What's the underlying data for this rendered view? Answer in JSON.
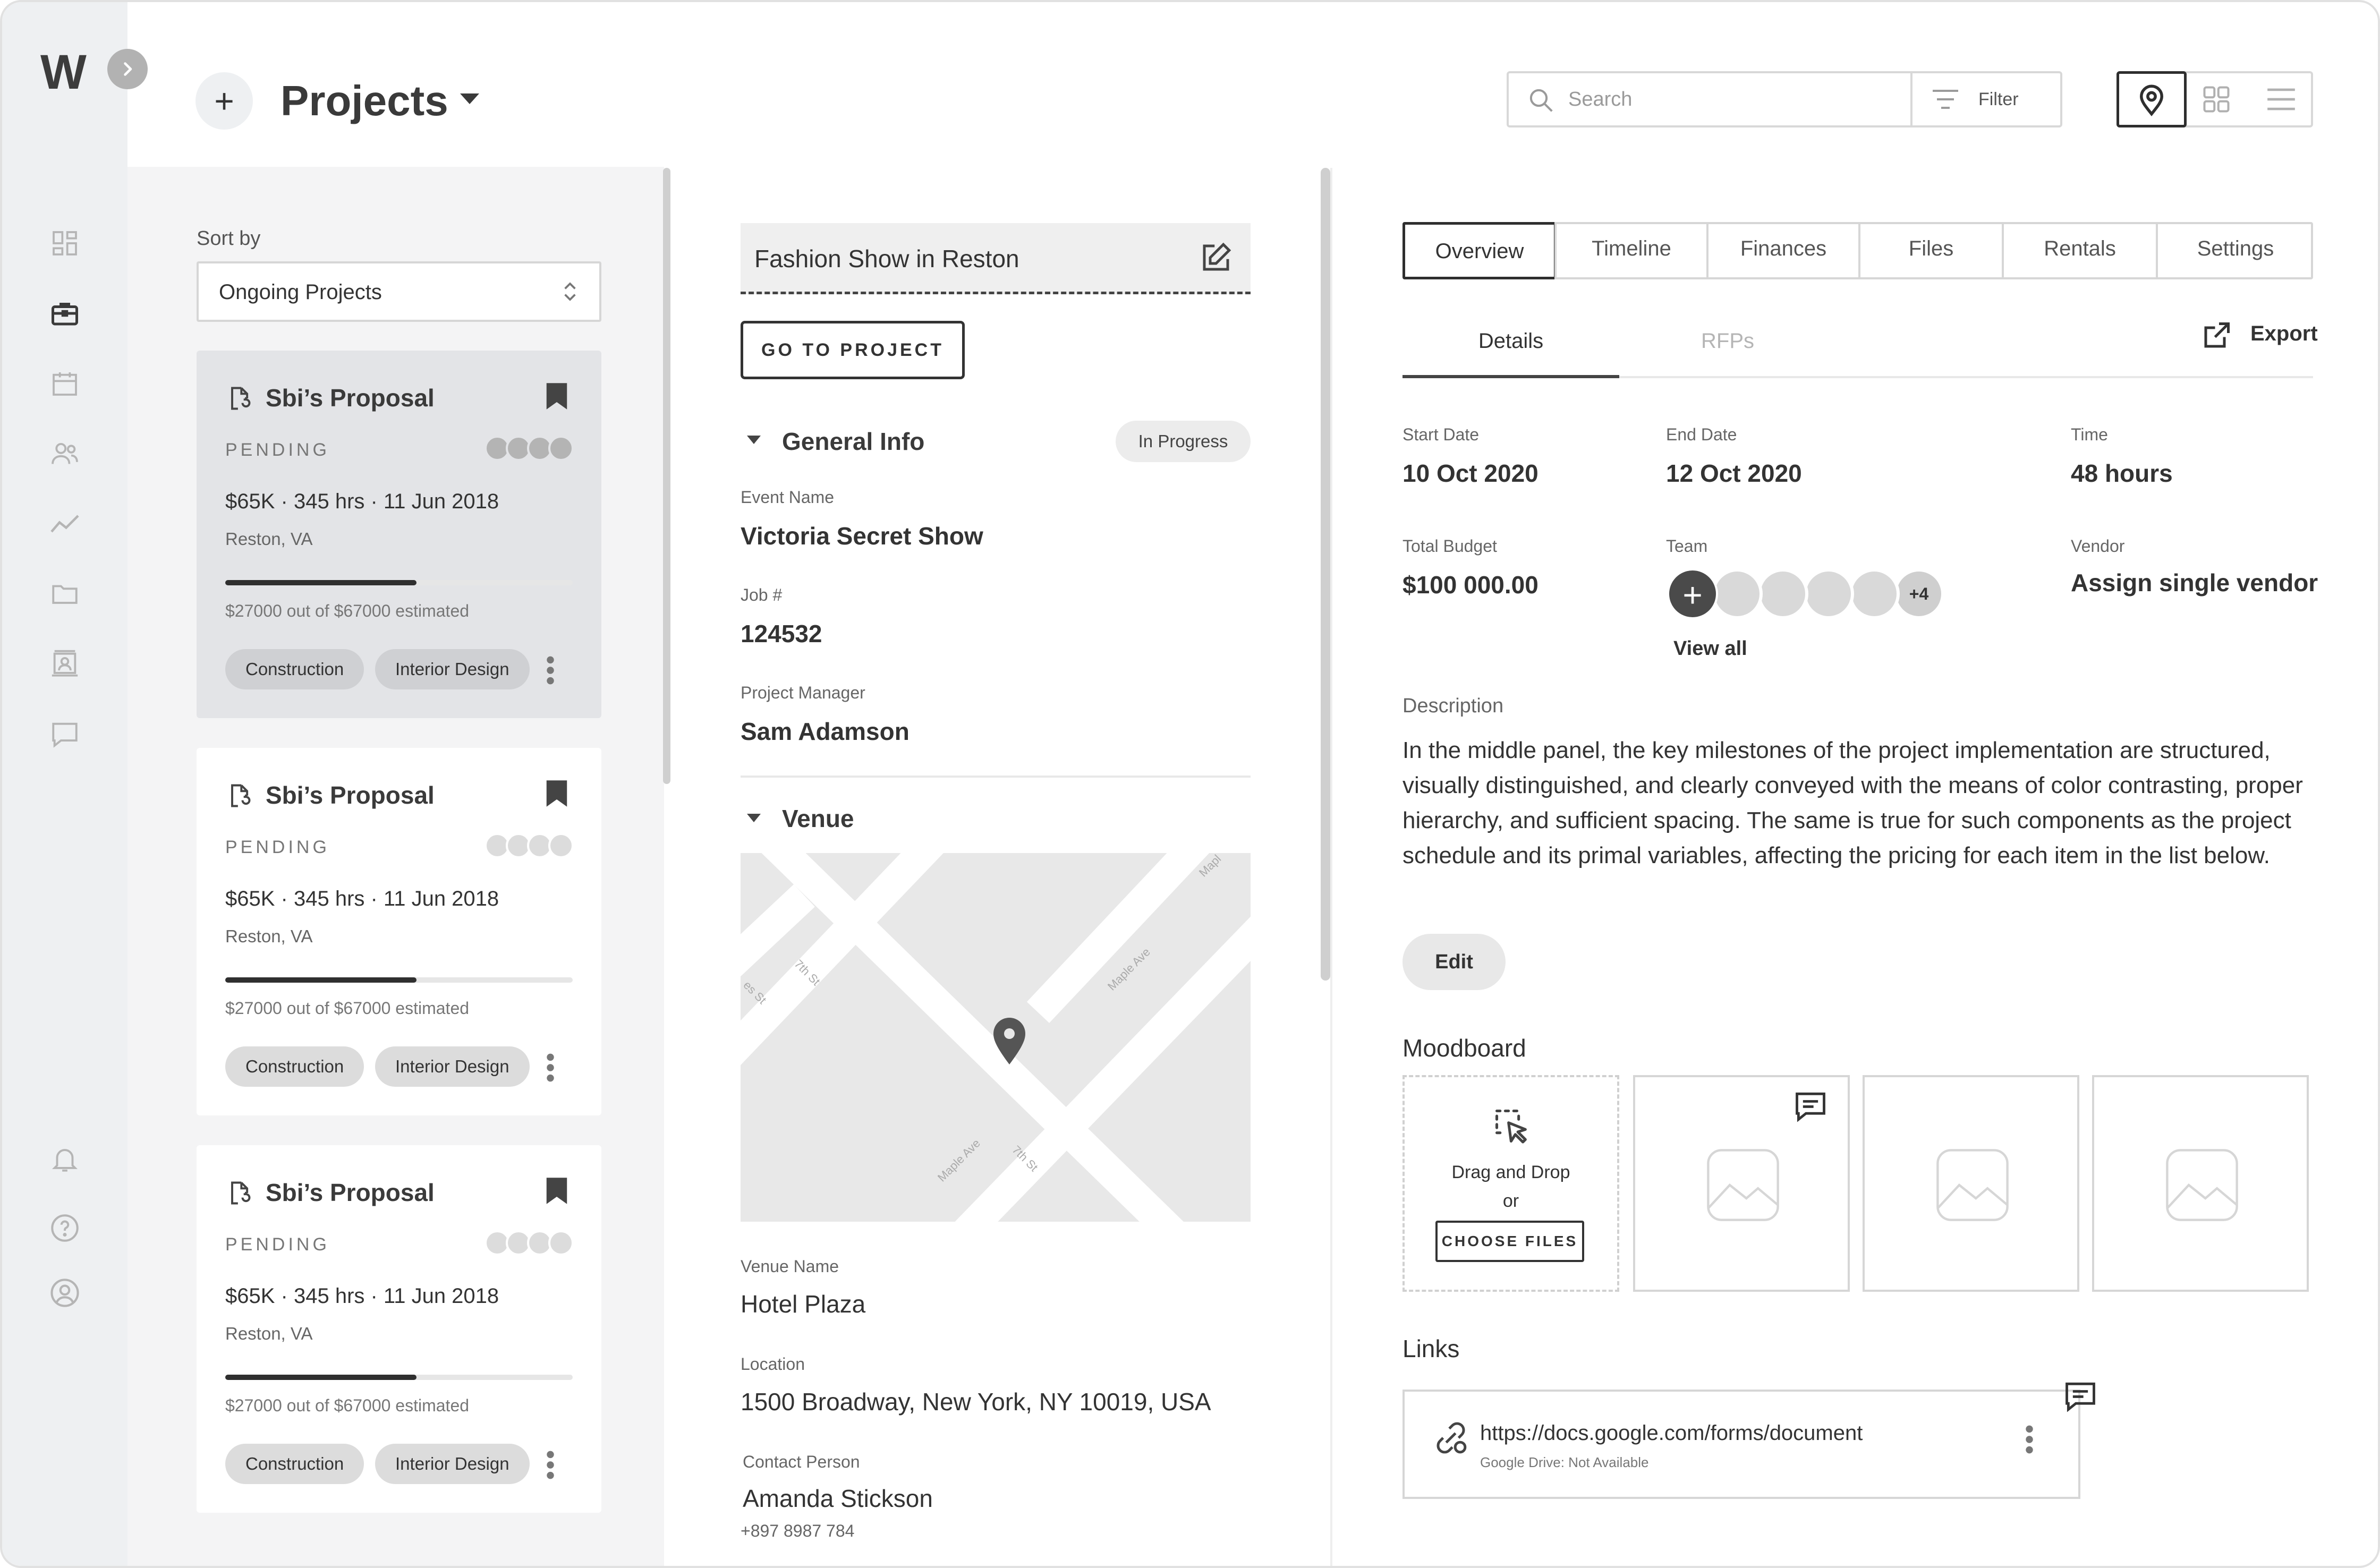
{
  "app": {
    "logo": "W",
    "brand_color": "#3c3c3c",
    "accent": "#2e2e2e"
  },
  "rail": {
    "toggle_icon": "chevron-right-icon",
    "nav": [
      {
        "name": "dashboard",
        "icon": "dashboard-icon"
      },
      {
        "name": "projects",
        "icon": "briefcase-icon",
        "active": true
      },
      {
        "name": "calendar",
        "icon": "calendar-icon"
      },
      {
        "name": "people",
        "icon": "people-icon"
      },
      {
        "name": "analytics",
        "icon": "trend-icon"
      },
      {
        "name": "files",
        "icon": "folder-icon"
      },
      {
        "name": "contacts",
        "icon": "contacts-icon"
      },
      {
        "name": "messages",
        "icon": "chat-icon"
      }
    ],
    "bottom": [
      {
        "name": "notifications",
        "icon": "bell-icon"
      },
      {
        "name": "help",
        "icon": "help-icon"
      },
      {
        "name": "profile",
        "icon": "user-icon"
      }
    ]
  },
  "header": {
    "add_symbol": "+",
    "title": "Projects",
    "search_placeholder": "Search",
    "filter_label": "Filter",
    "views": [
      "map-pin-icon",
      "grid-icon",
      "list-icon"
    ]
  },
  "list": {
    "sort_label": "Sort by",
    "sort_value": "Ongoing Projects",
    "cards": [
      {
        "title": "Sbi’s Proposal",
        "status": "PENDING",
        "meta": "$65K · 345 hrs · 11 Jun 2018",
        "location": "Reston, VA",
        "progress": 0.55,
        "estimate": "$27000 out of $67000 estimated",
        "tags": [
          "Construction",
          "Interior Design"
        ],
        "selected": true
      },
      {
        "title": "Sbi’s Proposal",
        "status": "PENDING",
        "meta": "$65K · 345 hrs · 11 Jun 2018",
        "location": "Reston, VA",
        "progress": 0.55,
        "estimate": "$27000 out of $67000 estimated",
        "tags": [
          "Construction",
          "Interior Design"
        ],
        "selected": false
      },
      {
        "title": "Sbi’s Proposal",
        "status": "PENDING",
        "meta": "$65K · 345 hrs · 11 Jun 2018",
        "location": "Reston, VA",
        "progress": 0.55,
        "estimate": "$27000 out of $67000 estimated",
        "tags": [
          "Construction",
          "Interior Design"
        ],
        "selected": false
      }
    ]
  },
  "summary": {
    "project_name": "Fashion Show in Reston",
    "goto_label": "GO TO PROJECT",
    "general_title": "General Info",
    "status": "In Progress",
    "event_name_label": "Event Name",
    "event_name": "Victoria Secret Show",
    "job_label": "Job #",
    "job": "124532",
    "pm_label": "Project Manager",
    "pm": "Sam Adamson",
    "venue_title": "Venue",
    "map_streets": [
      "Maple Ave",
      "7th St",
      "Maple Ave",
      "7th St",
      "Mapl",
      "es St"
    ],
    "venue_name_label": "Venue Name",
    "venue_name": "Hotel Plaza",
    "location_label": "Location",
    "location": "1500 Broadway, New York, NY 10019, USA",
    "contact_label": "Contact Person",
    "contact": "Amanda Stickson",
    "phone": "+897 8987 784"
  },
  "detail": {
    "tabs": [
      "Overview",
      "Timeline",
      "Finances",
      "Files",
      "Rentals",
      "Settings"
    ],
    "active_tab": "Overview",
    "subtabs": [
      "Details",
      "RFPs"
    ],
    "export_label": "Export",
    "start_date_label": "Start Date",
    "start_date": "10 Oct 2020",
    "end_date_label": "End Date",
    "end_date": "12 Oct 2020",
    "time_label": "Time",
    "time": "48 hours",
    "budget_label": "Total Budget",
    "budget": "$100 000.00",
    "team_label": "Team",
    "team_add": "+",
    "team_more": "+4",
    "view_all": "View all",
    "vendor_label": "Vendor",
    "vendor": "Assign single vendor",
    "description_label": "Description",
    "description": "In the middle panel, the key milestones of the project implementation are structured, visually distinguished, and clearly conveyed with the means of color contrasting, proper hierarchy, and sufficient spacing. The same is true for such components as the project schedule and its primal variables, affecting the pricing for each item in the list below.",
    "edit_label": "Edit",
    "moodboard_title": "Moodboard",
    "drop_text": "Drag and Drop",
    "drop_or": "or",
    "choose_files": "CHOOSE FILES",
    "links_title": "Links",
    "link_url": "https://docs.google.com/forms/document",
    "link_sub": "Google Drive: Not Available"
  }
}
